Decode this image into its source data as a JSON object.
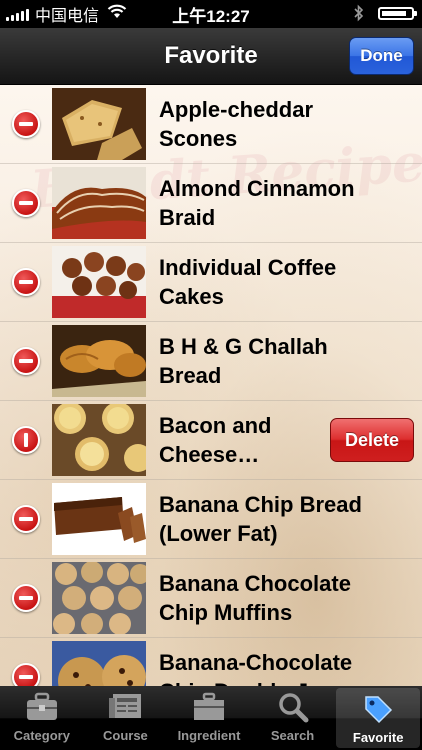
{
  "status_bar": {
    "carrier": "中国电信",
    "time": "上午12:27"
  },
  "nav": {
    "title": "Favorite",
    "done_label": "Done"
  },
  "watermark": "Bundt Recipes",
  "recipes": [
    {
      "title": "Apple-cheddar\nScones",
      "thumb": "scones-photo"
    },
    {
      "title": "Almond Cinnamon\nBraid",
      "thumb": "braid-photo"
    },
    {
      "title": "Individual Coffee\nCakes",
      "thumb": "coffee-cakes-photo"
    },
    {
      "title": "B H & G Challah\nBread",
      "thumb": "challah-photo"
    },
    {
      "title": "Bacon and\nCheese…",
      "thumb": "bacon-cheese-photo"
    },
    {
      "title": "Banana Chip Bread\n(Lower Fat)",
      "thumb": "banana-bread-photo"
    },
    {
      "title": "Banana Chocolate\nChip Muffins",
      "thumb": "muffins-photo"
    },
    {
      "title": "Banana-Chocolate\nChip Double-Ja…",
      "thumb": "choc-chip-photo"
    }
  ],
  "delete_label": "Delete",
  "tabs": [
    {
      "label": "Category",
      "icon": "briefcase-icon"
    },
    {
      "label": "Course",
      "icon": "newspaper-icon"
    },
    {
      "label": "Ingredient",
      "icon": "toolbox-icon"
    },
    {
      "label": "Search",
      "icon": "magnifier-icon"
    },
    {
      "label": "Favorite",
      "icon": "tag-icon"
    }
  ],
  "colors": {
    "done_blue": "#2f6be0",
    "delete_red": "#d42424",
    "minus_red": "#d21c1c"
  }
}
